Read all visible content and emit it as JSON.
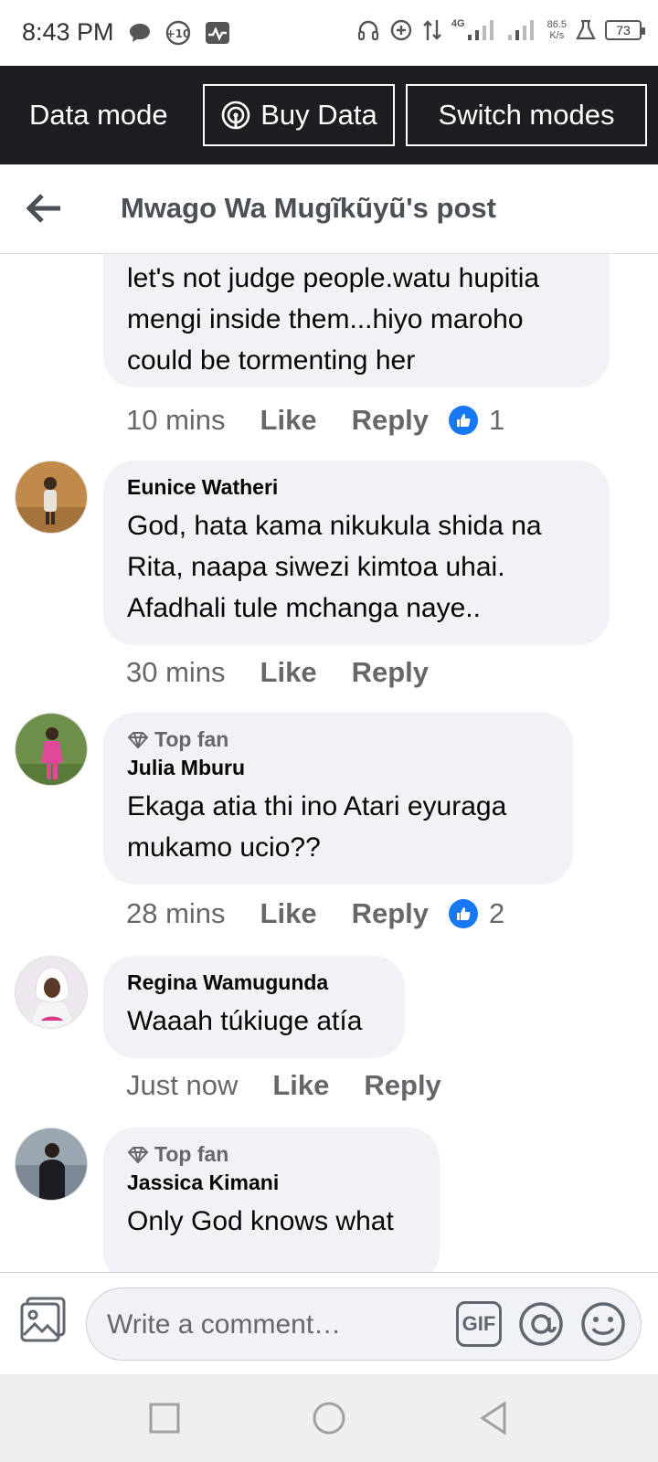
{
  "status_bar": {
    "time": "8:43 PM",
    "network": "4G",
    "speed_value": "86.5",
    "speed_unit": "K/s",
    "battery": "73"
  },
  "data_bar": {
    "label": "Data mode",
    "buy_label": "Buy Data",
    "switch_label": "Switch modes"
  },
  "header": {
    "title": "Mwago Wa Mugĩkũyũ's post"
  },
  "comments": [
    {
      "text": "let's not judge people.watu hupitia mengi inside them...hiyo maroho could be tormenting her",
      "time": "10 mins",
      "like": "Like",
      "reply": "Reply",
      "reactions": "1"
    },
    {
      "author": "Eunice Watheri",
      "text": "God, hata kama nikukula shida na Rita, naapa siwezi kimtoa uhai. Afadhali tule mchanga naye..",
      "time": "30 mins",
      "like": "Like",
      "reply": "Reply"
    },
    {
      "badge": "Top fan",
      "author": "Julia Mburu",
      "text": "Ekaga atia thi ino Atari eyuraga mukamo ucio??",
      "time": "28 mins",
      "like": "Like",
      "reply": "Reply",
      "reactions": "2"
    },
    {
      "author": "Regina Wamugunda",
      "text": "Waaah túkiuge atía",
      "time": "Just now",
      "like": "Like",
      "reply": "Reply"
    },
    {
      "badge": "Top fan",
      "author": "Jassica Kimani",
      "text": "Only God knows what"
    }
  ],
  "composer": {
    "placeholder": "Write a comment…",
    "gif_label": "GIF"
  },
  "colors": {
    "data_bar_bg": "#1c1e21",
    "bubble_bg": "#f0f2f5",
    "like_blue": "#1877f2"
  }
}
